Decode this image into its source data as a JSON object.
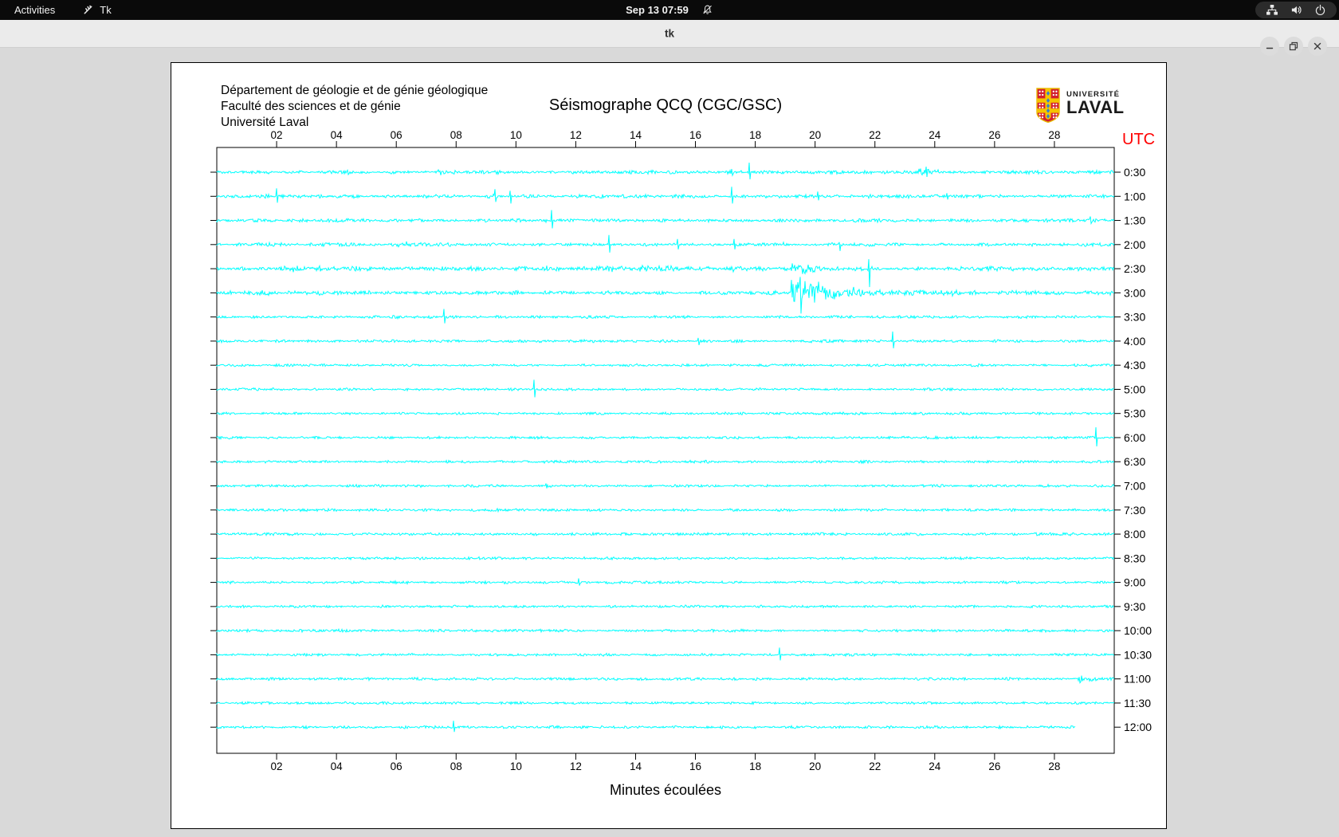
{
  "topbar": {
    "activities": "Activities",
    "app_name": "Tk",
    "clock": "Sep 13 07:59",
    "icons": [
      "tk-icon",
      "bell-muted-icon",
      "network-icon",
      "volume-icon",
      "power-icon"
    ]
  },
  "titlebar": {
    "title": "tk",
    "buttons": [
      "minimize",
      "restore",
      "close"
    ]
  },
  "window": {
    "header_lines": [
      "Département de géologie et de génie géologique",
      "Faculté des sciences et de génie",
      "Université Laval"
    ],
    "title": "Séismographe QCQ (CGC/GSC)",
    "logo": {
      "line1": "UNIVERSITÉ",
      "line2": "LAVAL"
    },
    "utc_label": "UTC",
    "xaxis_title": "Minutes écoulées"
  },
  "chart_data": {
    "type": "line",
    "title": "Séismographe QCQ (CGC/GSC)",
    "xlabel": "Minutes écoulées",
    "x_range_minutes": [
      0,
      30
    ],
    "x_ticks": [
      "02",
      "04",
      "06",
      "08",
      "10",
      "12",
      "14",
      "16",
      "18",
      "20",
      "22",
      "24",
      "26",
      "28"
    ],
    "trace_color": "#00ffff",
    "utc_color": "#ff0000",
    "grid": false,
    "right_axis_unit": "UTC",
    "rows": [
      {
        "label": "0:30",
        "base": 1.6,
        "events": [
          {
            "kind": "burst",
            "t": 4.3,
            "amp": 2.5,
            "dur": 0.5,
            "decay": 0.4
          },
          {
            "kind": "burst",
            "t": 7.4,
            "amp": 2.0,
            "dur": 0.4,
            "decay": 0.4
          },
          {
            "kind": "spike",
            "t": 17.2,
            "up": 4,
            "down": 4
          },
          {
            "kind": "spike",
            "t": 17.8,
            "up": 12,
            "down": 9
          },
          {
            "kind": "burst",
            "t": 23.4,
            "amp": 5.0,
            "dur": 0.9,
            "decay": 0.6
          },
          {
            "kind": "spike",
            "t": 23.7,
            "up": 7,
            "down": 6
          }
        ]
      },
      {
        "label": "1:00",
        "base": 1.6,
        "events": [
          {
            "kind": "spike",
            "t": 2.0,
            "up": 10,
            "down": 8
          },
          {
            "kind": "burst",
            "t": 7.3,
            "amp": 2.5,
            "dur": 0.5,
            "decay": 0.4
          },
          {
            "kind": "spike",
            "t": 9.3,
            "up": 9,
            "down": 7
          },
          {
            "kind": "spike",
            "t": 9.8,
            "up": 7,
            "down": 9
          },
          {
            "kind": "spike",
            "t": 17.2,
            "up": 12,
            "down": 9
          },
          {
            "kind": "spike",
            "t": 20.1,
            "up": 6,
            "down": 5
          },
          {
            "kind": "spike",
            "t": 24.4,
            "up": 4,
            "down": 4
          }
        ]
      },
      {
        "label": "1:30",
        "base": 1.6,
        "events": [
          {
            "kind": "burst",
            "t": 10.9,
            "amp": 3.0,
            "dur": 0.4,
            "decay": 0.3
          },
          {
            "kind": "spike",
            "t": 11.2,
            "up": 13,
            "down": 10
          },
          {
            "kind": "spike",
            "t": 29.2,
            "up": 5,
            "down": 4
          }
        ]
      },
      {
        "label": "2:00",
        "base": 1.6,
        "events": [
          {
            "kind": "burst",
            "t": 6.0,
            "amp": 3.5,
            "dur": 0.9,
            "decay": 0.7
          },
          {
            "kind": "spike",
            "t": 13.1,
            "up": 12,
            "down": 10
          },
          {
            "kind": "spike",
            "t": 15.4,
            "up": 7,
            "down": 6
          },
          {
            "kind": "spike",
            "t": 17.3,
            "up": 7,
            "down": 6
          },
          {
            "kind": "burst",
            "t": 18.9,
            "amp": 3.0,
            "dur": 0.4,
            "decay": 0.3
          },
          {
            "kind": "spike",
            "t": 20.8,
            "up": 3,
            "down": 8
          }
        ]
      },
      {
        "label": "2:30",
        "base": 2.0,
        "events": [
          {
            "kind": "burst",
            "t": 2.2,
            "amp": 2.5,
            "dur": 2.6,
            "decay": 2.2
          },
          {
            "kind": "burst",
            "t": 11.0,
            "amp": 2.5,
            "dur": 0.5,
            "decay": 0.4
          },
          {
            "kind": "burst",
            "t": 12.0,
            "amp": 1.5,
            "dur": 10.0,
            "decay": 20.0
          },
          {
            "kind": "burst",
            "t": 14.9,
            "amp": 3.5,
            "dur": 0.4,
            "decay": 0.3
          },
          {
            "kind": "burst",
            "t": 15.5,
            "amp": 3.0,
            "dur": 0.3,
            "decay": 0.3
          },
          {
            "kind": "burst",
            "t": 17.2,
            "amp": 4.0,
            "dur": 0.5,
            "decay": 0.4
          },
          {
            "kind": "burst",
            "t": 19.2,
            "amp": 8.0,
            "dur": 1.0,
            "decay": 0.7
          },
          {
            "kind": "spike",
            "t": 21.8,
            "up": 12,
            "down": 23
          }
        ]
      },
      {
        "label": "3:00",
        "base": 1.8,
        "events": [
          {
            "kind": "burst",
            "t": 0.8,
            "amp": 2.0,
            "dur": 3.5,
            "decay": 3.0
          },
          {
            "kind": "burst",
            "t": 8.4,
            "amp": 2.0,
            "dur": 0.4,
            "decay": 0.3
          },
          {
            "kind": "burst",
            "t": 19.2,
            "amp": 20.0,
            "dur": 2.2,
            "decay": 1.0
          },
          {
            "kind": "burst",
            "t": 19.4,
            "amp": 7.0,
            "dur": 4.0,
            "decay": 2.5
          },
          {
            "kind": "burst",
            "t": 19.5,
            "amp": 3.0,
            "dur": 10.5,
            "decay": 9.0
          },
          {
            "kind": "spike",
            "t": 19.5,
            "up": 20,
            "down": 26
          }
        ]
      },
      {
        "label": "3:30",
        "base": 1.3,
        "events": [
          {
            "kind": "spike",
            "t": 7.6,
            "up": 10,
            "down": 8
          }
        ]
      },
      {
        "label": "4:00",
        "base": 1.3,
        "events": [
          {
            "kind": "spike",
            "t": 16.1,
            "up": 4,
            "down": 5
          },
          {
            "kind": "spike",
            "t": 22.6,
            "up": 12,
            "down": 9
          }
        ]
      },
      {
        "label": "4:30",
        "base": 1.2,
        "events": []
      },
      {
        "label": "5:00",
        "base": 1.2,
        "events": [
          {
            "kind": "spike",
            "t": 10.6,
            "up": 12,
            "down": 10
          }
        ]
      },
      {
        "label": "5:30",
        "base": 1.2,
        "events": []
      },
      {
        "label": "6:00",
        "base": 1.2,
        "events": [
          {
            "kind": "spike",
            "t": 29.4,
            "up": 13,
            "down": 11
          }
        ]
      },
      {
        "label": "6:30",
        "base": 1.2,
        "events": []
      },
      {
        "label": "7:00",
        "base": 1.2,
        "events": [
          {
            "kind": "spike",
            "t": 11.0,
            "up": 3,
            "down": 3
          }
        ]
      },
      {
        "label": "7:30",
        "base": 1.2,
        "events": []
      },
      {
        "label": "8:00",
        "base": 1.3,
        "events": []
      },
      {
        "label": "8:30",
        "base": 1.2,
        "events": []
      },
      {
        "label": "9:00",
        "base": 1.2,
        "events": [
          {
            "kind": "spike",
            "t": 12.1,
            "up": 5,
            "down": 4
          }
        ]
      },
      {
        "label": "9:30",
        "base": 1.2,
        "events": []
      },
      {
        "label": "10:00",
        "base": 1.2,
        "events": []
      },
      {
        "label": "10:30",
        "base": 1.2,
        "events": [
          {
            "kind": "spike",
            "t": 18.8,
            "up": 9,
            "down": 7
          }
        ]
      },
      {
        "label": "11:00",
        "base": 1.3,
        "events": [
          {
            "kind": "burst",
            "t": 28.8,
            "amp": 5.0,
            "dur": 0.8,
            "decay": 0.6
          }
        ]
      },
      {
        "label": "11:30",
        "base": 1.2,
        "events": []
      },
      {
        "label": "12:00",
        "base": 1.3,
        "end": 28.7,
        "events": [
          {
            "kind": "spike",
            "t": 7.9,
            "up": 8,
            "down": 6
          }
        ]
      }
    ]
  }
}
